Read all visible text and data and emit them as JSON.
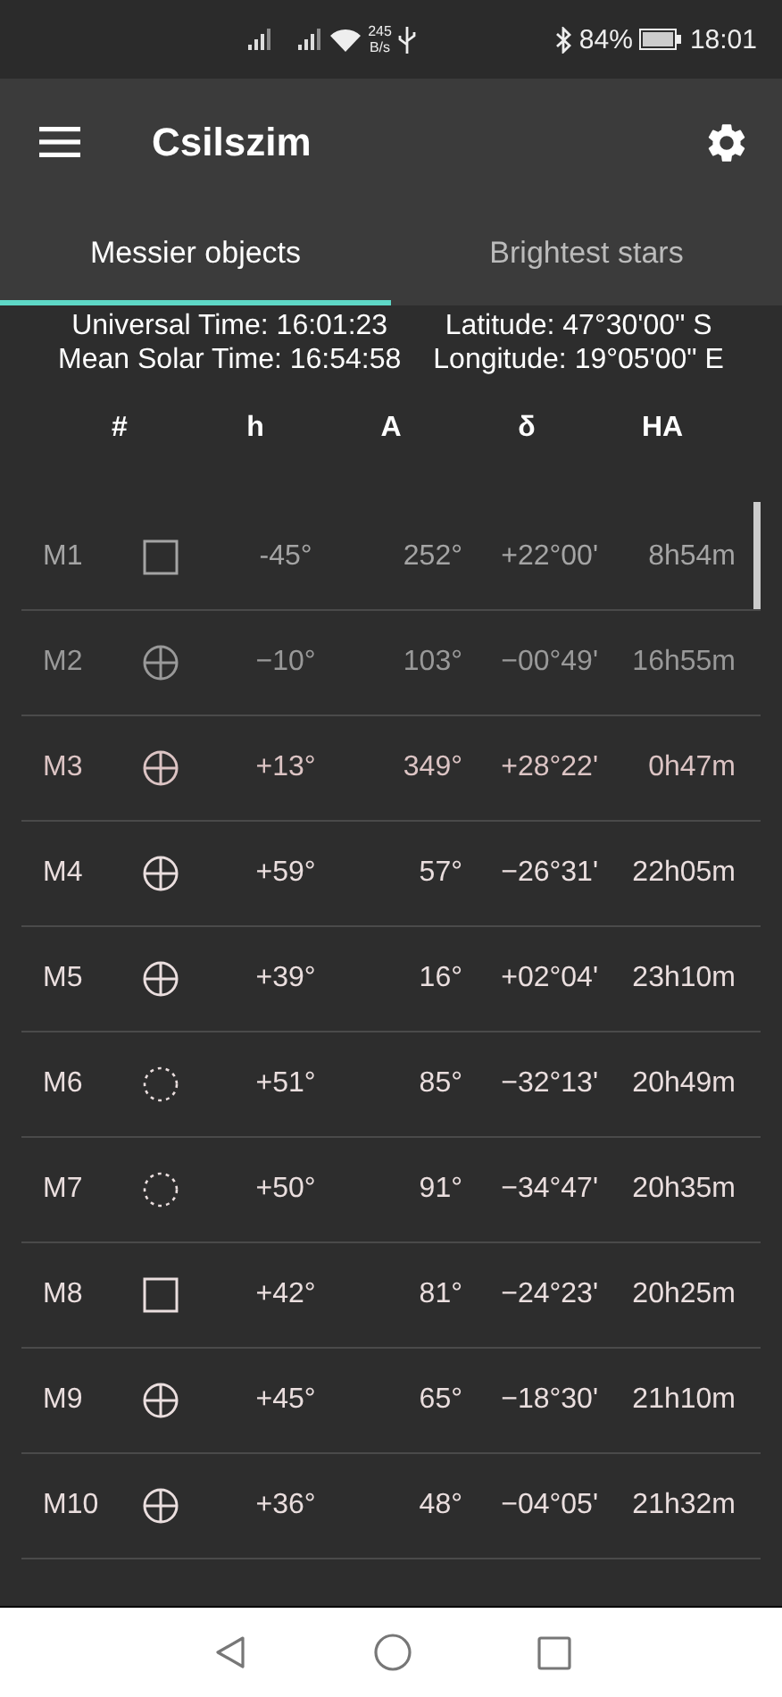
{
  "status_bar": {
    "net_speed": "245",
    "net_unit": "B/s",
    "battery": "84%",
    "time": "18:01"
  },
  "app_bar": {
    "title": "Csilszim"
  },
  "tabs": [
    {
      "label": "Messier objects",
      "selected": true
    },
    {
      "label": "Brightest stars",
      "selected": false
    }
  ],
  "info": {
    "universal_time": "Universal Time: 16:01:23",
    "latitude": "Latitude: 47°30'00\" S",
    "mean_solar_time": "Mean Solar Time: 16:54:58",
    "longitude": "Longitude: 19°05'00\" E"
  },
  "table": {
    "columns": [
      "#",
      "h",
      "A",
      "δ",
      "HA"
    ],
    "rows": [
      {
        "id": "M1",
        "kind": "square",
        "h": "-45°",
        "A": "252°",
        "dec": "+22°00'",
        "ha": "8h54m",
        "color": "#a4a4a4"
      },
      {
        "id": "M2",
        "kind": "cross-circle",
        "h": "−10°",
        "A": "103°",
        "dec": "−00°49'",
        "ha": "16h55m",
        "color": "#999999"
      },
      {
        "id": "M3",
        "kind": "cross-circle",
        "h": "+13°",
        "A": "349°",
        "dec": "+28°22'",
        "ha": "0h47m",
        "color": "#dcc4c4"
      },
      {
        "id": "M4",
        "kind": "cross-circle",
        "h": "+59°",
        "A": "57°",
        "dec": "−26°31'",
        "ha": "22h05m",
        "color": "#eadede"
      },
      {
        "id": "M5",
        "kind": "cross-circle",
        "h": "+39°",
        "A": "16°",
        "dec": "+02°04'",
        "ha": "23h10m",
        "color": "#eadede"
      },
      {
        "id": "M6",
        "kind": "dotted-circle",
        "h": "+51°",
        "A": "85°",
        "dec": "−32°13'",
        "ha": "20h49m",
        "color": "#eadede"
      },
      {
        "id": "M7",
        "kind": "dotted-circle",
        "h": "+50°",
        "A": "91°",
        "dec": "−34°47'",
        "ha": "20h35m",
        "color": "#eadede"
      },
      {
        "id": "M8",
        "kind": "square",
        "h": "+42°",
        "A": "81°",
        "dec": "−24°23'",
        "ha": "20h25m",
        "color": "#eadede"
      },
      {
        "id": "M9",
        "kind": "cross-circle",
        "h": "+45°",
        "A": "65°",
        "dec": "−18°30'",
        "ha": "21h10m",
        "color": "#eadede"
      },
      {
        "id": "M10",
        "kind": "cross-circle",
        "h": "+36°",
        "A": "48°",
        "dec": "−04°05'",
        "ha": "21h32m",
        "color": "#eadede"
      }
    ]
  }
}
